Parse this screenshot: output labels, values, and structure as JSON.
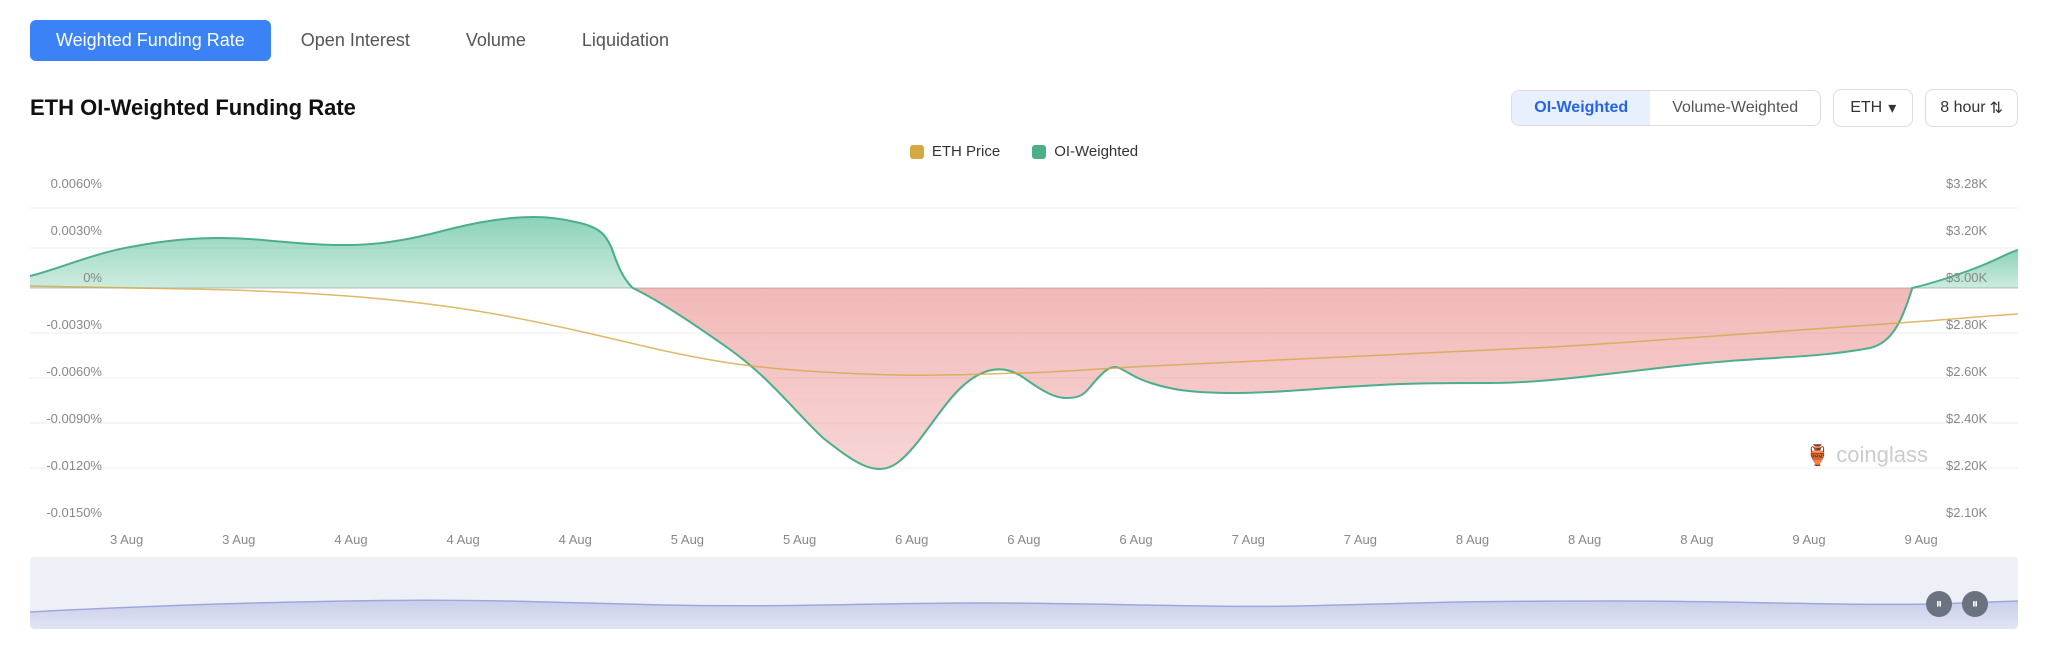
{
  "tabs": [
    {
      "label": "Weighted Funding Rate",
      "active": true
    },
    {
      "label": "Open Interest",
      "active": false
    },
    {
      "label": "Volume",
      "active": false
    },
    {
      "label": "Liquidation",
      "active": false
    }
  ],
  "chart": {
    "title": "ETH OI-Weighted Funding Rate",
    "weight_options": [
      {
        "label": "OI-Weighted",
        "active": true
      },
      {
        "label": "Volume-Weighted",
        "active": false
      }
    ],
    "asset": "ETH",
    "timeframe": "8 hour",
    "legend": [
      {
        "label": "ETH Price",
        "color": "#d4a843"
      },
      {
        "label": "OI-Weighted",
        "color": "#4caf8a"
      }
    ],
    "y_axis_left": [
      "0.0060%",
      "0.0030%",
      "0%",
      "-0.0030%",
      "-0.0060%",
      "-0.0090%",
      "-0.0120%",
      "-0.0150%"
    ],
    "y_axis_right": [
      "$3.28K",
      "$3.20K",
      "$3.00K",
      "$2.80K",
      "$2.60K",
      "$2.40K",
      "$2.20K",
      "$2.10K"
    ],
    "x_axis": [
      "3 Aug",
      "3 Aug",
      "4 Aug",
      "4 Aug",
      "4 Aug",
      "5 Aug",
      "5 Aug",
      "6 Aug",
      "6 Aug",
      "6 Aug",
      "7 Aug",
      "7 Aug",
      "8 Aug",
      "8 Aug",
      "8 Aug",
      "9 Aug",
      "9 Aug"
    ],
    "watermark": "coinglass"
  }
}
